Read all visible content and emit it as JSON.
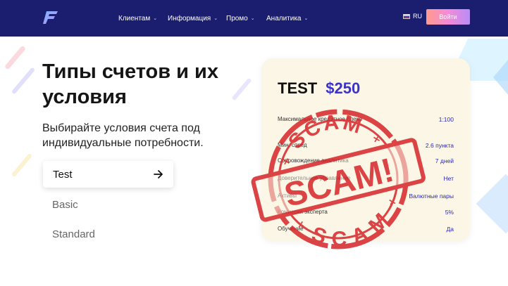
{
  "header": {
    "nav": [
      {
        "label": "Клиентам"
      },
      {
        "label": "Информация"
      },
      {
        "label": "Промо"
      },
      {
        "label": "Аналитика"
      }
    ],
    "language": "RU",
    "login_label": "Войти"
  },
  "main": {
    "title": "Типы счетов и их условия",
    "subtitle": "Выбирайте условия счета под индивидуальные потребности.",
    "account_types": [
      {
        "label": "Test"
      },
      {
        "label": "Basic"
      },
      {
        "label": "Standard"
      }
    ]
  },
  "card": {
    "name": "TEST",
    "price": "$250",
    "rows": [
      {
        "label": "Максимальное кредитное плечо",
        "value": "1:100"
      },
      {
        "label": "Мин. спред",
        "value": "2.6 пункта"
      },
      {
        "label": "Сопровождение аналитика",
        "value": "7 дней"
      },
      {
        "label": "Доверительное управление",
        "value": "Нет"
      },
      {
        "label": "Активы",
        "value": "Валютные пары"
      },
      {
        "label": "Комиссия эксперта",
        "value": "5%"
      },
      {
        "label": "Обучение",
        "value": "Да"
      }
    ]
  },
  "stamp": {
    "top_text": "SCAM",
    "center_text": "SCAM!",
    "bottom_text": "SCAM",
    "color": "#d6262a"
  },
  "colors": {
    "header_bg": "#1b1d6e",
    "accent": "#3a33c9",
    "card_bg": "#fbf6e6"
  }
}
